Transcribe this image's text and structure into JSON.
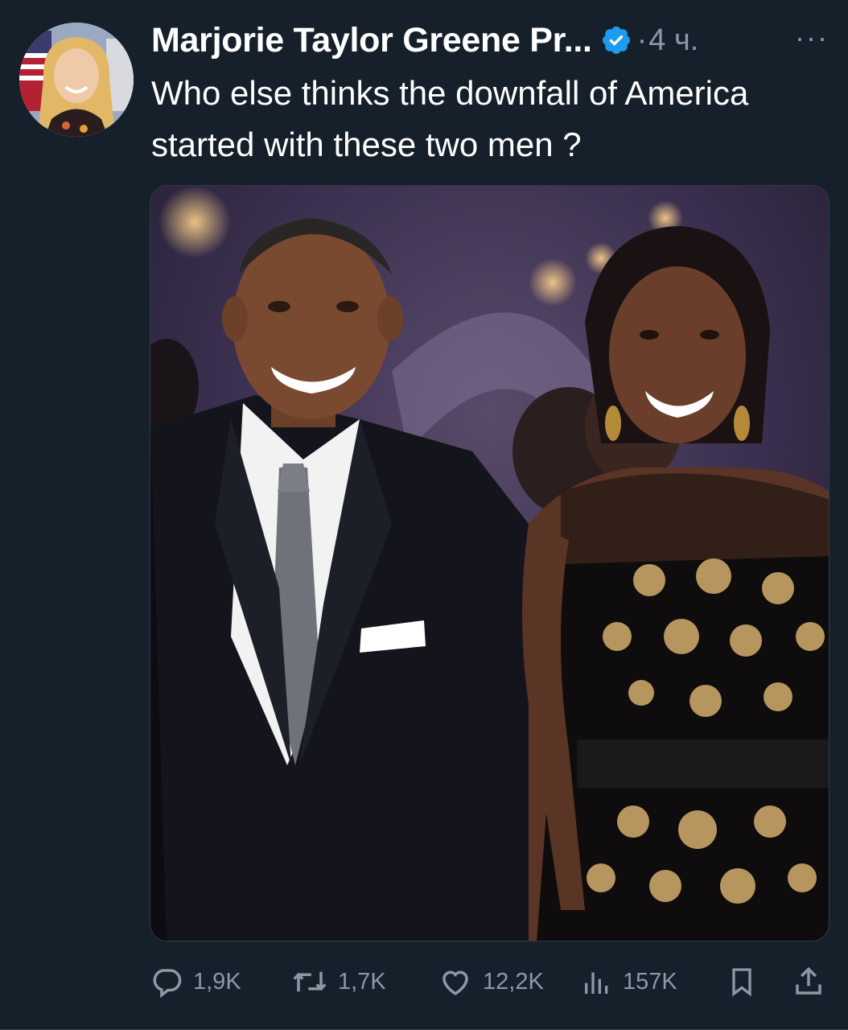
{
  "tweet": {
    "author": "Marjorie Taylor Greene Pr...",
    "separator": "·",
    "time": "4 ч.",
    "more": "···",
    "text": "Who else thinks the downfall of America started with these two men ?"
  },
  "actions": {
    "replies": "1,9K",
    "retweets": "1,7K",
    "likes": "12,2K",
    "views": "157K"
  },
  "icons": {
    "verified": "verified-badge-icon",
    "reply": "reply-icon",
    "retweet": "retweet-icon",
    "like": "heart-icon",
    "views": "views-icon",
    "bookmark": "bookmark-icon",
    "share": "share-icon"
  },
  "colors": {
    "background": "#15202b",
    "text": "#ffffff",
    "secondary": "#8b98a5",
    "verified": "#1d9bf0"
  }
}
